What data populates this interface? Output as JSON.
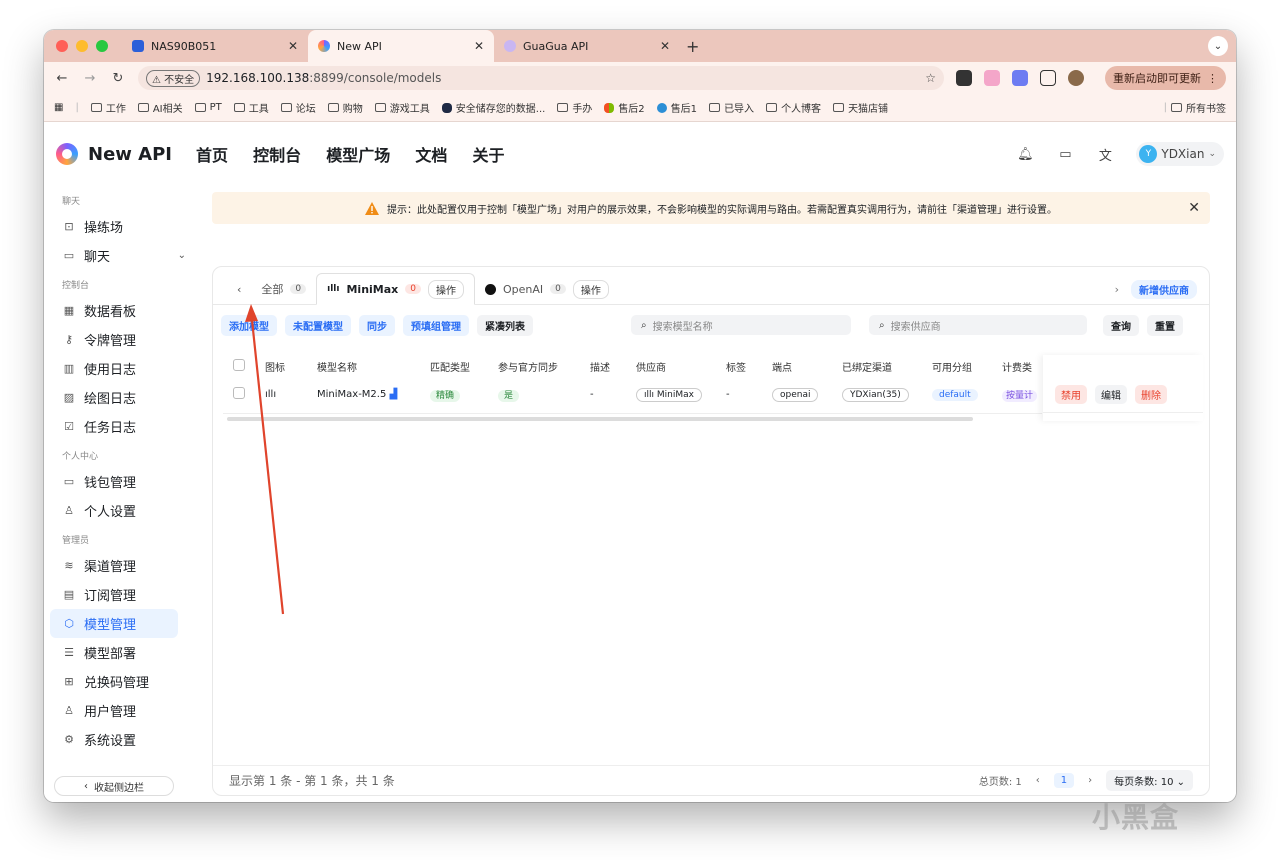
{
  "browser": {
    "tabs": [
      {
        "title": "NAS90B051",
        "active": false
      },
      {
        "title": "New API",
        "active": true
      },
      {
        "title": "GuaGua API",
        "active": false
      }
    ],
    "url_badge": "不安全",
    "url_host": "192.168.100.138",
    "url_path": ":8899/console/models",
    "update_label": "重新启动即可更新",
    "bookmarks": [
      "工作",
      "AI相关",
      "PT",
      "工具",
      "论坛",
      "购物",
      "游戏工具",
      "安全储存您的数据...",
      "手办",
      "售后2",
      "售后1",
      "已导入",
      "个人博客",
      "天猫店铺"
    ],
    "all_bookmarks": "所有书签"
  },
  "header": {
    "brand": "New API",
    "nav": [
      "首页",
      "控制台",
      "模型广场",
      "文档",
      "关于"
    ],
    "user": "YDXian",
    "avatar_letter": "Y"
  },
  "sidebar": {
    "sections": [
      {
        "title": "聊天",
        "items": [
          {
            "label": "操练场",
            "icon": "playground-icon"
          },
          {
            "label": "聊天",
            "icon": "chat-icon",
            "expandable": true
          }
        ]
      },
      {
        "title": "控制台",
        "items": [
          {
            "label": "数据看板",
            "icon": "dashboard-icon"
          },
          {
            "label": "令牌管理",
            "icon": "key-icon"
          },
          {
            "label": "使用日志",
            "icon": "chart-icon"
          },
          {
            "label": "绘图日志",
            "icon": "image-icon"
          },
          {
            "label": "任务日志",
            "icon": "checklist-icon"
          }
        ]
      },
      {
        "title": "个人中心",
        "items": [
          {
            "label": "钱包管理",
            "icon": "wallet-icon"
          },
          {
            "label": "个人设置",
            "icon": "user-icon"
          }
        ]
      },
      {
        "title": "管理员",
        "items": [
          {
            "label": "渠道管理",
            "icon": "layers-icon"
          },
          {
            "label": "订阅管理",
            "icon": "calendar-icon"
          },
          {
            "label": "模型管理",
            "icon": "cube-icon",
            "active": true
          },
          {
            "label": "模型部署",
            "icon": "server-icon"
          },
          {
            "label": "兑换码管理",
            "icon": "gift-icon"
          },
          {
            "label": "用户管理",
            "icon": "user-icon"
          },
          {
            "label": "系统设置",
            "icon": "settings-icon"
          }
        ]
      }
    ],
    "collapse_label": "收起侧边栏"
  },
  "notice": {
    "text": "提示：此处配置仅用于控制「模型广场」对用户的展示效果，不会影响模型的实际调用与路由。若需配置真实调用行为，请前往「渠道管理」进行设置。"
  },
  "vendor_tabs": {
    "all_label": "全部",
    "all_count": "0",
    "tabs": [
      {
        "label": "MiniMax",
        "count": "0",
        "op": "操作",
        "active": true
      },
      {
        "label": "OpenAI",
        "count": "0",
        "op": "操作",
        "active": false
      }
    ],
    "new_vendor": "新增供应商"
  },
  "actions": {
    "add_model": "添加模型",
    "unconfigured": "未配置模型",
    "sync": "同步",
    "prefill": "预填组管理",
    "compact": "紧凑列表",
    "search_model_placeholder": "搜索模型名称",
    "search_vendor_placeholder": "搜索供应商",
    "query": "查询",
    "reset": "重置"
  },
  "table": {
    "columns": [
      "图标",
      "模型名称",
      "匹配类型",
      "参与官方同步",
      "描述",
      "供应商",
      "标签",
      "端点",
      "已绑定渠道",
      "可用分组",
      "计费类"
    ],
    "rows": [
      {
        "model": "MiniMax-M2.5",
        "match": "精确",
        "sync": "是",
        "desc": "-",
        "vendor": "MiniMax",
        "tags": "-",
        "endpoint": "openai",
        "channels": "YDXian(35)",
        "group": "default",
        "billing": "按量计",
        "actions": [
          "禁用",
          "编辑",
          "删除"
        ]
      }
    ]
  },
  "footer": {
    "summary": "显示第 1 条 - 第 1 条，共 1 条",
    "total_pages": "总页数: 1",
    "current_page": "1",
    "page_size": "每页条数: 10"
  },
  "watermark": "小黑盒",
  "colors": {
    "accent": "#2a6df4",
    "danger": "#e8402b",
    "tabstrip": "#ecc7bd",
    "annotation_arrow": "#e0442c"
  }
}
